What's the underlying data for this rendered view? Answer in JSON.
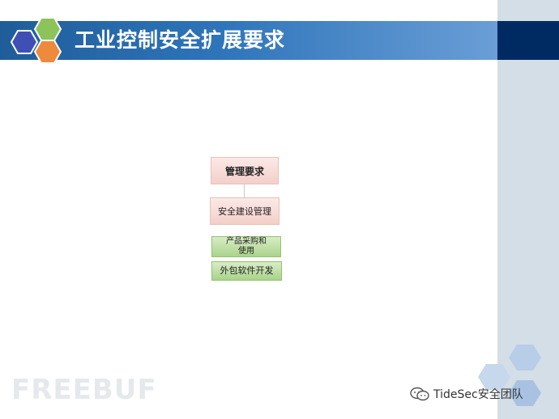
{
  "slide": {
    "title": "工业控制安全扩展要求"
  },
  "tree": {
    "root": "管理要求",
    "level1": "安全建设管理",
    "children": [
      "产品采购和\n使用",
      "外包软件开发"
    ]
  },
  "watermarks": {
    "left": "FREEBUF",
    "right": "TideSec安全团队"
  },
  "colors": {
    "title_blue": "#2f75bb",
    "title_dark": "#002b62",
    "node_pink": "#f3cfc9",
    "node_green": "#a9d38b"
  },
  "icons": [
    "hexagon-logo",
    "wechat-icon"
  ]
}
